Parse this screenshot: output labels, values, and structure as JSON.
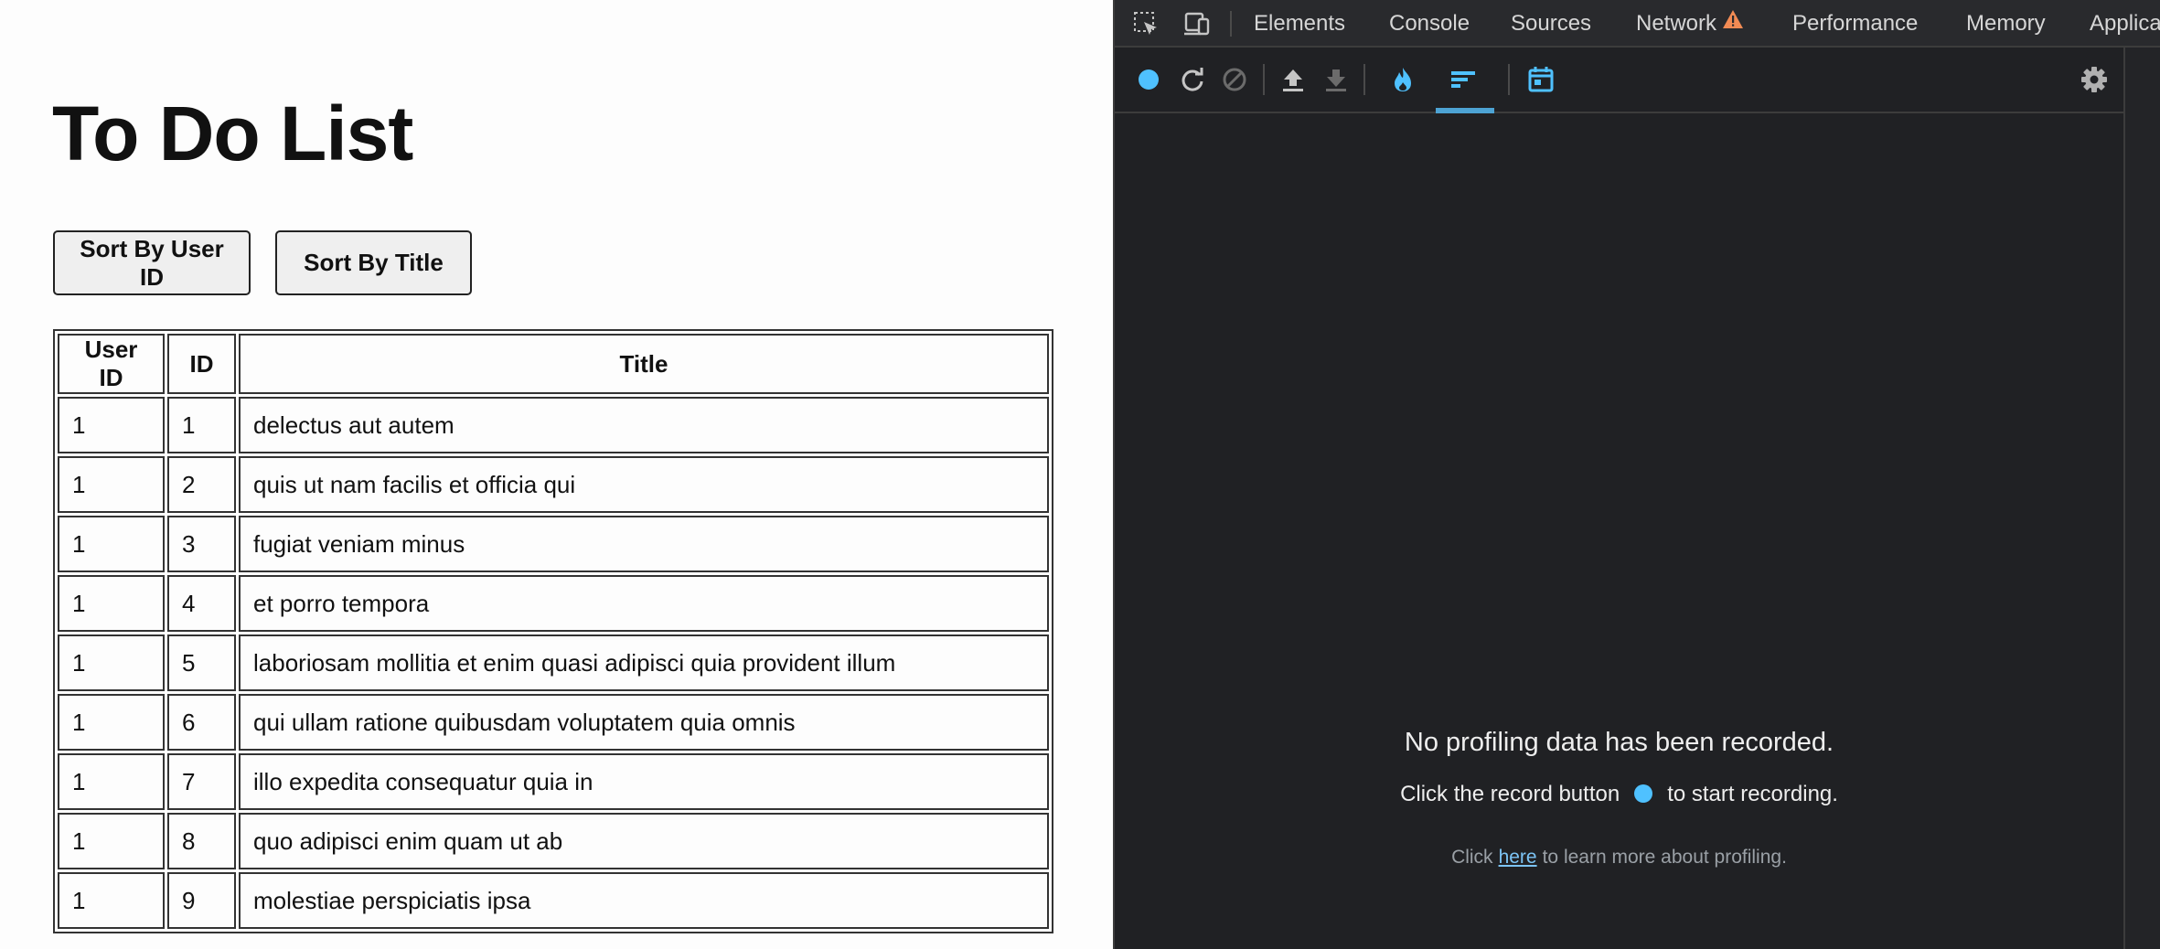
{
  "page": {
    "title": "To Do List",
    "buttons": {
      "sort_user_id": "Sort By User ID",
      "sort_title": "Sort By Title"
    },
    "table": {
      "headers": [
        "User ID",
        "ID",
        "Title"
      ],
      "rows": [
        {
          "user_id": "1",
          "id": "1",
          "title": "delectus aut autem"
        },
        {
          "user_id": "1",
          "id": "2",
          "title": "quis ut nam facilis et officia qui"
        },
        {
          "user_id": "1",
          "id": "3",
          "title": "fugiat veniam minus"
        },
        {
          "user_id": "1",
          "id": "4",
          "title": "et porro tempora"
        },
        {
          "user_id": "1",
          "id": "5",
          "title": "laboriosam mollitia et enim quasi adipisci quia provident illum"
        },
        {
          "user_id": "1",
          "id": "6",
          "title": "qui ullam ratione quibusdam voluptatem quia omnis"
        },
        {
          "user_id": "1",
          "id": "7",
          "title": "illo expedita consequatur quia in"
        },
        {
          "user_id": "1",
          "id": "8",
          "title": "quo adipisci enim quam ut ab"
        },
        {
          "user_id": "1",
          "id": "9",
          "title": "molestiae perspiciatis ipsa"
        }
      ]
    }
  },
  "devtools": {
    "tabs": [
      "Elements",
      "Console",
      "Sources",
      "Network",
      "Performance",
      "Memory",
      "Applica"
    ],
    "network_warning_icon": "warning-triangle-icon",
    "toolbar_icons": [
      "record-icon",
      "reload-icon",
      "clear-icon",
      "upload-icon",
      "download-icon",
      "flame-chart-icon",
      "ranked-chart-icon",
      "timeline-icon",
      "settings-icon"
    ],
    "empty_state": {
      "title": "No profiling data has been recorded.",
      "hint_before": "Click the record button",
      "hint_after": "to start recording.",
      "learn_before": "Click",
      "learn_link": "here",
      "learn_after": "to learn more about profiling."
    },
    "colors": {
      "background": "#202124",
      "accent": "#4fc1ff",
      "warning": "#f28b54"
    }
  }
}
